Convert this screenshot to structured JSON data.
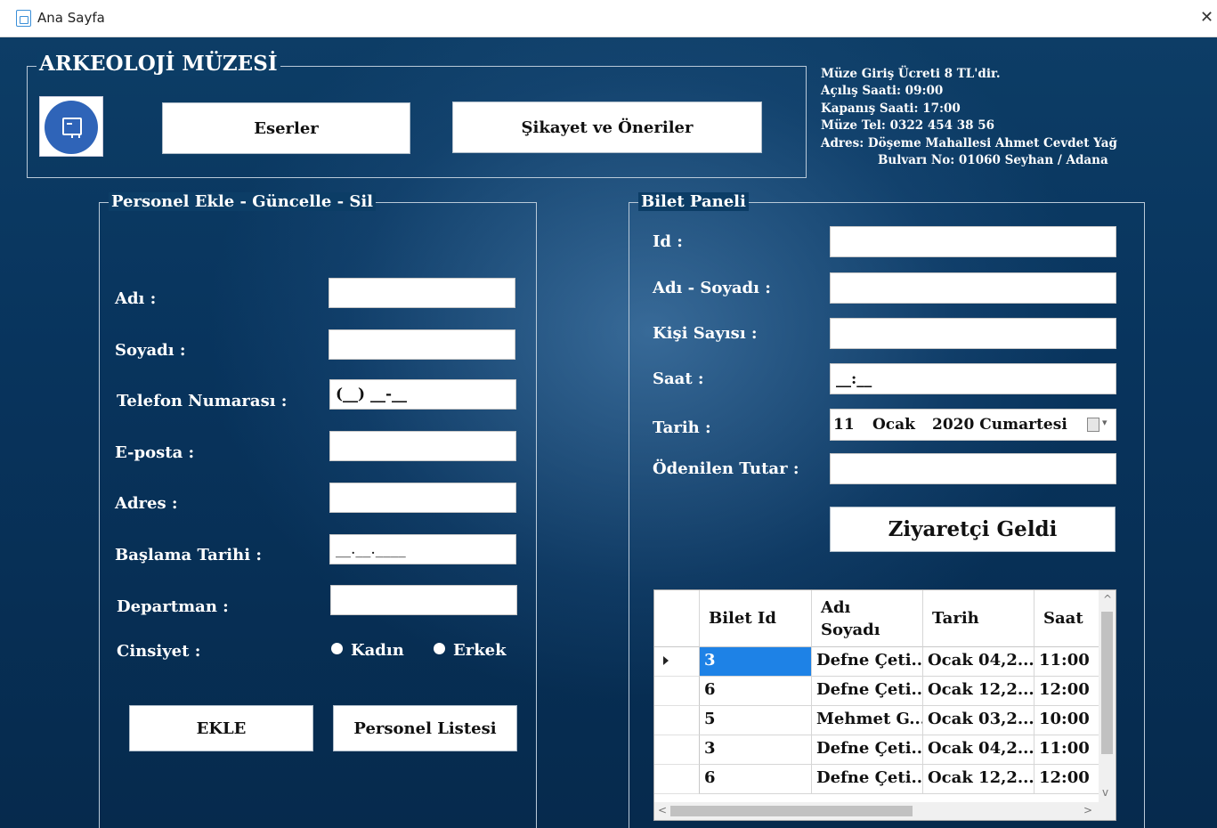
{
  "window": {
    "title": "Ana Sayfa",
    "close_glyph": "✕"
  },
  "header": {
    "group_title": "ARKEOLOJİ MÜZESİ",
    "logo_icon": "museum-logo-icon",
    "eserler_label": "Eserler",
    "sikayet_label": "Şikayet ve Öneriler"
  },
  "info": {
    "line1": "Müze Giriş Ücreti 8 TL'dir.",
    "line2": "Açılış Saati: 09:00",
    "line3": "Kapanış Saati: 17:00",
    "line4": "Müze Tel: 0322 454 38 56",
    "line5": "Adres: Döşeme Mahallesi Ahmet Cevdet Yağ",
    "line6": "Bulvarı No: 01060 Seyhan / Adana"
  },
  "personel": {
    "group_title": "Personel Ekle - Güncelle - Sil",
    "labels": {
      "adi": "Adı  :",
      "soyadi": "Soyadı :",
      "telefon": "Telefon Numarası :",
      "eposta": "E-posta :",
      "adres": "Adres :",
      "baslama": "Başlama Tarihi :",
      "departman": "Departman :",
      "cinsiyet": "Cinsiyet :"
    },
    "values": {
      "adi": "",
      "soyadi": "",
      "telefon": "(__) __-__",
      "eposta": "",
      "adres": "",
      "baslama": "__.__.____",
      "departman": ""
    },
    "radio_kadin": "Kadın",
    "radio_erkek": "Erkek",
    "ekle_label": "EKLE",
    "liste_label": "Personel Listesi"
  },
  "bilet": {
    "group_title": "Bilet Paneli",
    "labels": {
      "id": "Id :",
      "adsoyad": "Adı - Soyadı :",
      "kisi": "Kişi Sayısı :",
      "saat": "Saat :",
      "tarih": "Tarih :",
      "tutar": "Ödenilen Tutar :"
    },
    "values": {
      "id": "",
      "adsoyad": "",
      "kisi": "",
      "saat": "__:__",
      "tutar": ""
    },
    "date": {
      "day": "11",
      "month": "Ocak",
      "year_day": "2020 Cumartesi"
    },
    "geldi_label": "Ziyaretçi Geldi",
    "grid": {
      "columns": [
        "Bilet Id",
        "Adı Soyadı",
        "Tarih",
        "Saat"
      ],
      "rows": [
        [
          "3",
          "Defne Çeti...",
          "Ocak 04,2...",
          "11:00"
        ],
        [
          "6",
          "Defne Çeti...",
          "Ocak 12,2...",
          "12:00"
        ],
        [
          "5",
          "Mehmet G...",
          "Ocak 03,2...",
          "10:00"
        ],
        [
          "3",
          "Defne Çeti...",
          "Ocak 04,2...",
          "11:00"
        ],
        [
          "6",
          "Defne Çeti...",
          "Ocak 12,2...",
          "12:00"
        ]
      ]
    }
  }
}
